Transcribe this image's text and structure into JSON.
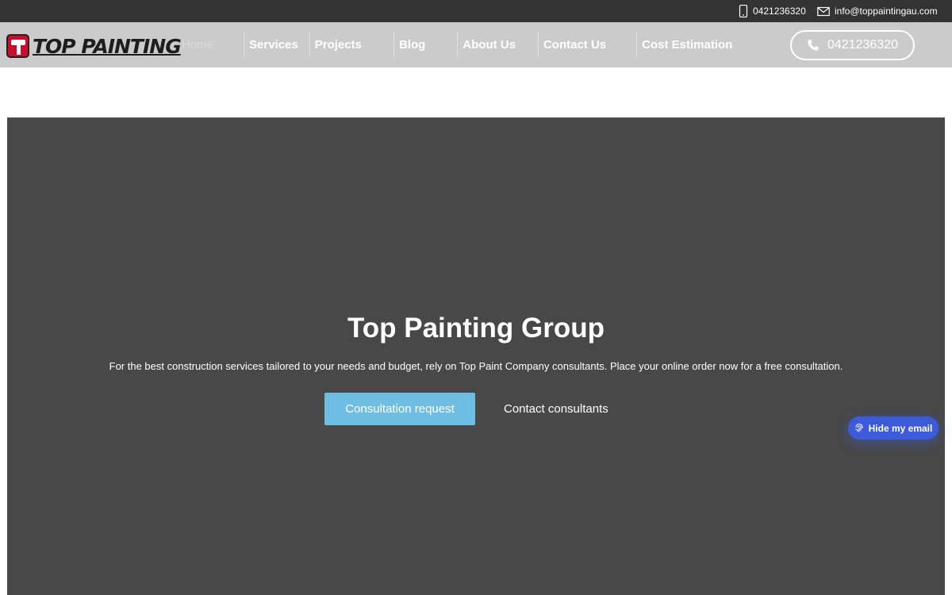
{
  "topbar": {
    "phone": "0421236320",
    "email": "info@toppaintingau.com",
    "phone_icon": "mobile-phone-icon",
    "email_icon": "envelope-icon"
  },
  "logo": {
    "text": "TOP PAINTING",
    "colors": {
      "badge": "#c8102e"
    }
  },
  "nav": {
    "items": [
      {
        "label": "Home",
        "active": true
      },
      {
        "label": "Services"
      },
      {
        "label": "Projects"
      },
      {
        "label": "Blog"
      },
      {
        "label": "About Us"
      },
      {
        "label": "Contact Us"
      },
      {
        "label": "Cost Estimation"
      }
    ],
    "call_button": {
      "label": "0421236320",
      "icon": "phone-icon"
    }
  },
  "hero": {
    "title": "Top Painting Group",
    "subtitle": "For the best construction services tailored to your needs and budget, rely on Top Paint Company consultants. Place your online order now for a free consultation.",
    "primary_button": "Consultation request",
    "secondary_button": "Contact consultants",
    "colors": {
      "background": "#484848",
      "primary_button": "#6ebee4"
    }
  },
  "widget": {
    "label": "Hide my email",
    "icon": "fingerprint-icon",
    "colors": {
      "background": "#3b5bdb"
    }
  }
}
